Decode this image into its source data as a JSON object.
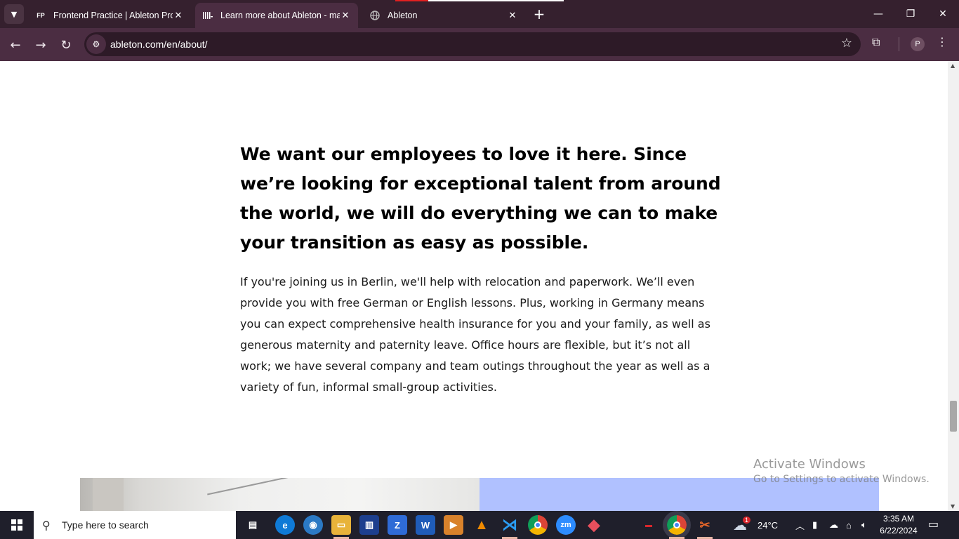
{
  "browser": {
    "tabs": [
      {
        "favicon": "FP",
        "title": "Frontend Practice | Ableton Pro",
        "active": false
      },
      {
        "favicon": "||||",
        "title": "Learn more about Ableton - ma",
        "active": true
      },
      {
        "favicon": "globe",
        "title": "Ableton",
        "active": false
      }
    ],
    "url": "ableton.com/en/about/",
    "profile_initial": "P"
  },
  "page": {
    "heading": "We want our employees to love it here. Since we’re looking for exceptional talent from around the world, we will do everything we can to make your transition as easy as possible.",
    "body": "If you're joining us in Berlin, we'll help with relocation and paperwork. We’ll even provide you with free German or English lessons. Plus, working in Germany means you can expect comprehensive health insurance for you and your family, as well as generous maternity and paternity leave. Office hours are flexible, but it’s not all work; we have several company and team outings throughout the year as well as a variety of fun, informal small-group activities."
  },
  "watermark": {
    "line1": "Activate Windows",
    "line2": "Go to Settings to activate Windows."
  },
  "taskbar": {
    "search_placeholder": "Type here to search",
    "weather_temp": "24°C",
    "weather_badge": "1",
    "time": "3:35 AM",
    "date": "6/22/2024"
  },
  "colors": {
    "tabbar": "#35202e",
    "toolbar": "#4b2d42",
    "image_block_blue": "#b0c1ff"
  }
}
